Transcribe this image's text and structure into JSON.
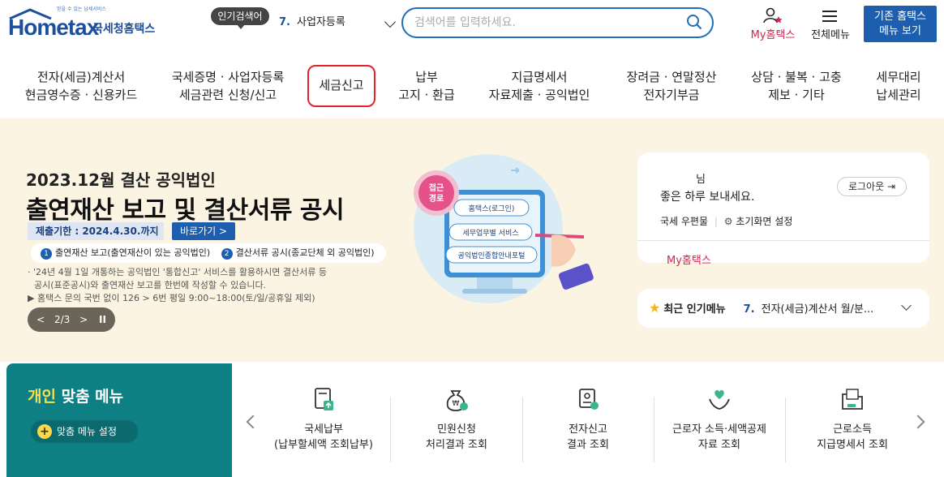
{
  "header": {
    "logo": {
      "slogan": "믿을 수 있는 납세서비스",
      "brand": "Hometax",
      "name": "국세청홈택스"
    },
    "popular_label": "인기검색어",
    "popular_item": {
      "rank": "7.",
      "text": "사업자등록"
    },
    "search_placeholder": "검색어를 입력하세요.",
    "my_label": "My홈택스",
    "all_menu_label": "전체메뉴",
    "old_menu": {
      "line1": "기존 홈택스",
      "line2": "메뉴 보기"
    }
  },
  "nav": [
    {
      "l1": "전자(세금)계산서",
      "l2": "현금영수증 · 신용카드"
    },
    {
      "l1": "국세증명 · 사업자등록",
      "l2": "세금관련 신청/신고"
    },
    {
      "l1": "세금신고",
      "l2": ""
    },
    {
      "l1": "납부",
      "l2": "고지 · 환급"
    },
    {
      "l1": "지급명세서",
      "l2": "자료제출 · 공익법인"
    },
    {
      "l1": "장려금 · 연말정산",
      "l2": "전자기부금"
    },
    {
      "l1": "상담 · 불복 · 고충",
      "l2": "제보 · 기타"
    },
    {
      "l1": "세무대리",
      "l2": "납세관리"
    }
  ],
  "banner": {
    "title1": "2023.12월 결산 공익법인",
    "title2": "출연재산 보고 및 결산서류 공시",
    "deadline": "제출기한 : 2024.4.30.까지",
    "go_label": "바로가기 >",
    "item1": "출연재산 보고(출연재산이 있는 공익법인)",
    "item2": "결산서류 공시(종교단체 외 공익법인)",
    "note1": "· '24년 4월 1일 개통하는 공익법인 '통합신고' 서비스를 활용하시면 결산서류 등",
    "note2": "공시(표준공시)와 출연재산 보고를 한번에 작성할 수 있습니다.",
    "note3": "▶ 홈택스 문의 국번 없이 126 > 6번 평일 9:00~18:00(토/일/공휴일 제외)",
    "pager": "2/3",
    "illus": {
      "badge": "접근경로",
      "step1": "홈택스(로그인)",
      "step2": "세무업무별 서비스",
      "step3": "공익법인종합안내포털"
    }
  },
  "user_card": {
    "name_suffix": "님",
    "greeting": "좋은 하루 보내세요.",
    "logout": "로그아웃",
    "mailbox": "국세 우편물",
    "home_setting": "초기화면 설정",
    "my": "My홈택스"
  },
  "recent": {
    "title": "최근 인기메뉴",
    "rank": "7.",
    "text": "전자(세금)계산서 월/분..."
  },
  "personal_menu": {
    "title_highlight": "개인",
    "title_rest": " 맞춤 메뉴",
    "setting": "맞춤 메뉴 설정"
  },
  "services": [
    {
      "l1": "국세납부",
      "l2": "(납부할세액 조회납부)"
    },
    {
      "l1": "민원신청",
      "l2": "처리결과 조회"
    },
    {
      "l1": "전자신고",
      "l2": "결과 조회"
    },
    {
      "l1": "근로자 소득·세액공제",
      "l2": "자료 조회"
    },
    {
      "l1": "근로소득",
      "l2": "지급명세서 조회"
    }
  ],
  "colors": {
    "brand": "#1d5fae",
    "highlight": "#e0242c",
    "teal": "#0e7f83",
    "banner_bg": "#fcf4e2"
  }
}
